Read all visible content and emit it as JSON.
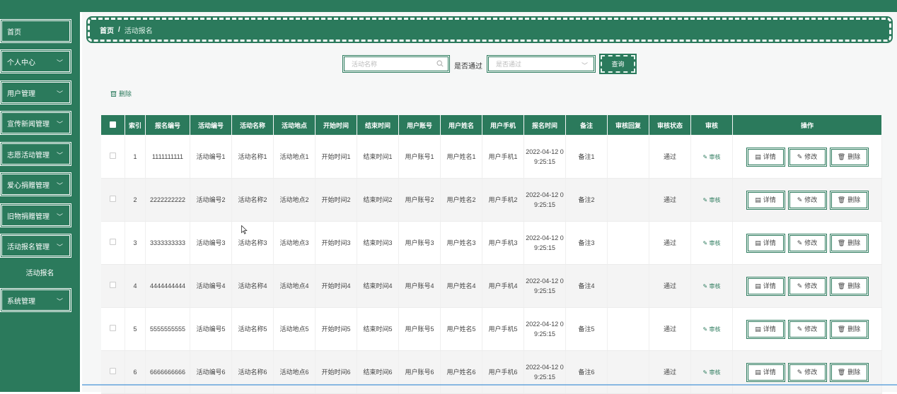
{
  "sidebar": {
    "items": [
      {
        "label": "首页",
        "has_chevron": false
      },
      {
        "label": "个人中心",
        "has_chevron": true
      },
      {
        "label": "用户管理",
        "has_chevron": true
      },
      {
        "label": "宣传新闻管理",
        "has_chevron": true
      },
      {
        "label": "志愿活动管理",
        "has_chevron": true
      },
      {
        "label": "爱心捐赠管理",
        "has_chevron": true
      },
      {
        "label": "旧物捐赠管理",
        "has_chevron": true
      },
      {
        "label": "活动报名管理",
        "has_chevron": true
      },
      {
        "label": "系统管理",
        "has_chevron": true
      }
    ],
    "sub_item": {
      "label": "活动报名"
    }
  },
  "breadcrumb": {
    "home": "首页",
    "separator": "/",
    "current": "活动报名"
  },
  "search": {
    "placeholder": "活动名称",
    "pass_label": "是否通过",
    "pass_placeholder": "是否通过",
    "query_label": "查询"
  },
  "actions": {
    "delete_label": "删除"
  },
  "table": {
    "headers": [
      "索引",
      "报名编号",
      "活动编号",
      "活动名称",
      "活动地点",
      "开始时间",
      "结束时间",
      "用户账号",
      "用户姓名",
      "用户手机",
      "报名时间",
      "备注",
      "审核回复",
      "审核状态",
      "审核",
      "操作"
    ],
    "rows": [
      {
        "index": "1",
        "reg_no": "1111111111",
        "act_no": "活动编号1",
        "act_name": "活动名称1",
        "place": "活动地点1",
        "start": "开始时间1",
        "end": "结束时间1",
        "account": "用户账号1",
        "name": "用户姓名1",
        "phone": "用户手机1",
        "reg_time": "2022-04-12 09:25:15",
        "note": "备注1",
        "reply": "",
        "status": "通过"
      },
      {
        "index": "2",
        "reg_no": "2222222222",
        "act_no": "活动编号2",
        "act_name": "活动名称2",
        "place": "活动地点2",
        "start": "开始时间2",
        "end": "结束时间2",
        "account": "用户账号2",
        "name": "用户姓名2",
        "phone": "用户手机2",
        "reg_time": "2022-04-12 09:25:15",
        "note": "备注2",
        "reply": "",
        "status": "通过"
      },
      {
        "index": "3",
        "reg_no": "3333333333",
        "act_no": "活动编号3",
        "act_name": "活动名称3",
        "place": "活动地点3",
        "start": "开始时间3",
        "end": "结束时间3",
        "account": "用户账号3",
        "name": "用户姓名3",
        "phone": "用户手机3",
        "reg_time": "2022-04-12 09:25:15",
        "note": "备注3",
        "reply": "",
        "status": "通过"
      },
      {
        "index": "4",
        "reg_no": "4444444444",
        "act_no": "活动编号4",
        "act_name": "活动名称4",
        "place": "活动地点4",
        "start": "开始时间4",
        "end": "结束时间4",
        "account": "用户账号4",
        "name": "用户姓名4",
        "phone": "用户手机4",
        "reg_time": "2022-04-12 09:25:15",
        "note": "备注4",
        "reply": "",
        "status": "通过"
      },
      {
        "index": "5",
        "reg_no": "5555555555",
        "act_no": "活动编号5",
        "act_name": "活动名称5",
        "place": "活动地点5",
        "start": "开始时间5",
        "end": "结束时间5",
        "account": "用户账号5",
        "name": "用户姓名5",
        "phone": "用户手机5",
        "reg_time": "2022-04-12 09:25:15",
        "note": "备注5",
        "reply": "",
        "status": "通过"
      },
      {
        "index": "6",
        "reg_no": "6666666666",
        "act_no": "活动编号6",
        "act_name": "活动名称6",
        "place": "活动地点6",
        "start": "开始时间6",
        "end": "结束时间6",
        "account": "用户账号6",
        "name": "用户姓名6",
        "phone": "用户手机6",
        "reg_time": "2022-04-12 09:25:15",
        "note": "备注6",
        "reply": "",
        "status": "通过"
      }
    ],
    "audit_label": "审核",
    "op_labels": {
      "detail": "详情",
      "edit": "修改",
      "delete": "删除"
    }
  },
  "colors": {
    "brand": "#2b7a5c"
  }
}
